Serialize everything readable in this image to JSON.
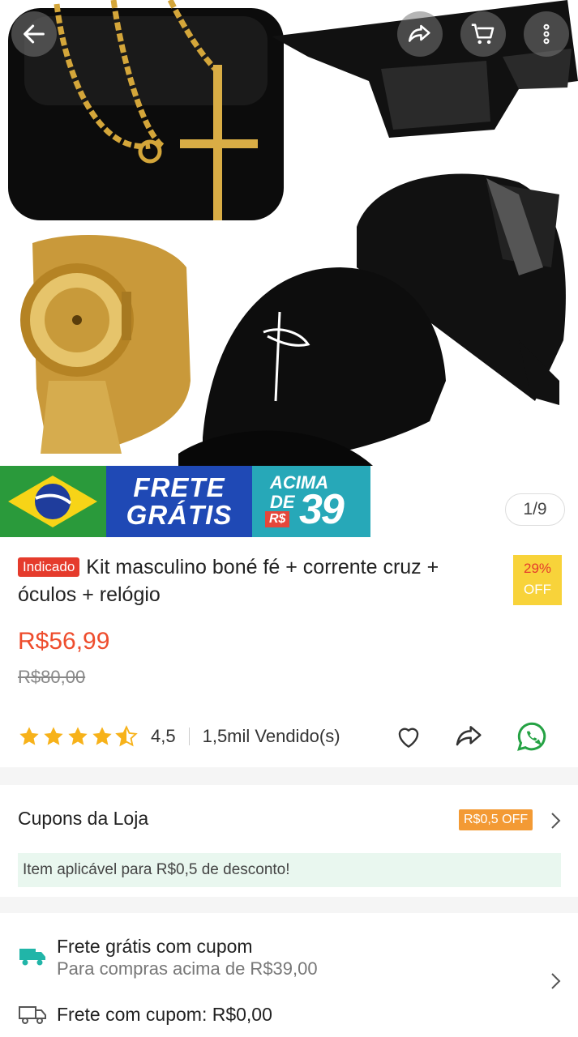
{
  "top_bar": {
    "back_icon": "arrow-left-icon",
    "share_icon": "share-icon",
    "cart_icon": "cart-icon",
    "more_icon": "more-vertical-icon"
  },
  "banner": {
    "frete_line1": "FRETE",
    "frete_line2": "GRÁTIS",
    "acima_line1": "ACIMA",
    "acima_line2": "DE",
    "currency": "R$",
    "amount": "39"
  },
  "gallery": {
    "counter": "1/9"
  },
  "product": {
    "badge": "Indicado",
    "title": "Kit masculino boné fé + corrente cruz + óculos + relógio",
    "discount_pct": "29%",
    "discount_word": "OFF",
    "price": "R$56,99",
    "old_price": "R$80,00",
    "rating": "4,5",
    "rating_stars": 4.5,
    "sold": "1,5mil Vendido(s)"
  },
  "coupons": {
    "label": "Cupons da Loja",
    "tag": "R$0,5 OFF",
    "note": "Item aplicável para R$0,5 de desconto!"
  },
  "shipping": {
    "free_title": "Frete grátis com cupom",
    "free_sub": "Para compras acima de R$39,00",
    "coupon_line": "Frete com cupom: R$0,00"
  },
  "colors": {
    "accent": "#ee4d2d",
    "star": "#f7b21a",
    "whatsapp": "#25a244",
    "truck": "#21b5a8"
  }
}
